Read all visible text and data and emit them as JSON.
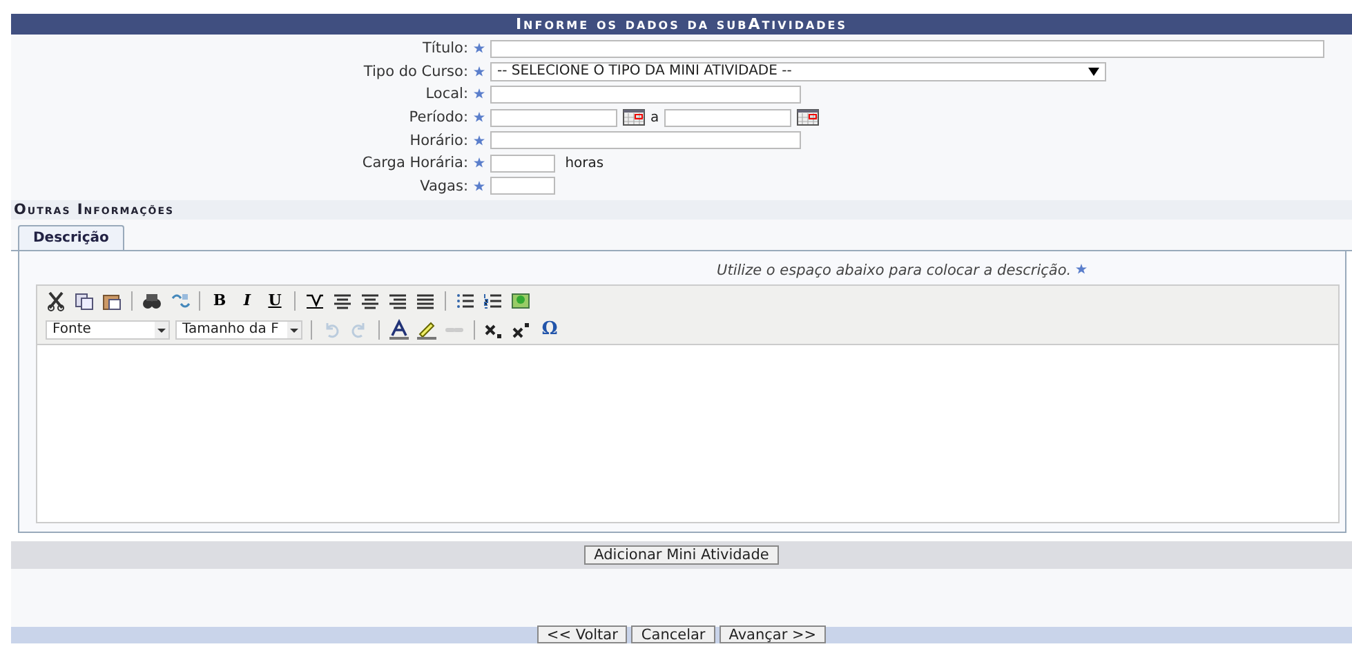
{
  "form": {
    "title": "Informe os dados da subAtividades",
    "fields": [
      {
        "kind": "wide_text",
        "label": "Título:"
      },
      {
        "kind": "select",
        "label": "Tipo do Curso:",
        "value": "-- SELECIONE O TIPO DA MINI ATIVIDADE --"
      },
      {
        "kind": "text",
        "label": "Local:"
      },
      {
        "kind": "period",
        "label": "Período:",
        "separator": "a"
      },
      {
        "kind": "text",
        "label": "Horário:"
      },
      {
        "kind": "short_text",
        "label": "Carga Horária:",
        "suffix": "horas"
      },
      {
        "kind": "short_text",
        "label": "Vagas:"
      }
    ]
  },
  "other_info": {
    "title": "Outras Informações",
    "tabs": [
      {
        "label": "Descrição",
        "selected": true
      }
    ],
    "hint": "Utilize o espaço abaixo para colocar a descrição.",
    "toolbar": [
      [
        {
          "kind": "icon"
        },
        {
          "kind": "icon"
        },
        {
          "kind": "icon"
        },
        {
          "kind": "sep"
        },
        {
          "kind": "icon"
        },
        {
          "kind": "icon"
        },
        {
          "kind": "sep"
        },
        {
          "kind": "glyph",
          "label": "B"
        },
        {
          "kind": "glyph",
          "label": "I"
        },
        {
          "kind": "glyph",
          "label": "U"
        },
        {
          "kind": "sep"
        },
        {
          "kind": "icon"
        },
        {
          "kind": "icon"
        },
        {
          "kind": "icon"
        },
        {
          "kind": "icon"
        },
        {
          "kind": "icon"
        },
        {
          "kind": "sep"
        },
        {
          "kind": "icon"
        },
        {
          "kind": "icon"
        },
        {
          "kind": "icon"
        }
      ],
      [
        {
          "kind": "dropdown",
          "label": "Fonte"
        },
        {
          "kind": "dropdown",
          "label": "Tamanho da F"
        },
        {
          "kind": "sep"
        },
        {
          "kind": "icon"
        },
        {
          "kind": "icon"
        },
        {
          "kind": "sep"
        },
        {
          "kind": "icon"
        },
        {
          "kind": "icon"
        },
        {
          "kind": "icon"
        },
        {
          "kind": "sep"
        },
        {
          "kind": "icon"
        },
        {
          "kind": "icon"
        },
        {
          "kind": "glyph",
          "label": "Ω"
        }
      ]
    ]
  },
  "add_button": "Adicionar Mini Atividade",
  "nav_buttons": [
    "<< Voltar",
    "Cancelar",
    "Avançar >>"
  ]
}
